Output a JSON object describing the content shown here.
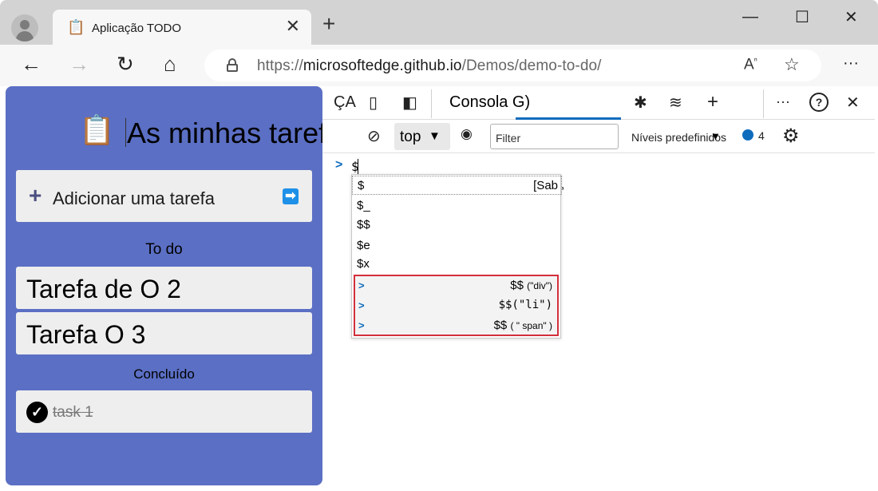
{
  "browser": {
    "tab_title": "Aplicação TODO",
    "tab_icon": "📋",
    "url_prefix": "https://",
    "url_host": "microsoftedge.github.io",
    "url_path": "/Demos/demo-to-do/",
    "read_aloud_label": "A",
    "read_aloud_mark": "ⁿ",
    "new_tab_icon": "+",
    "close_tab_icon": "✕",
    "more_icon": "···",
    "minimize_icon": "—",
    "maximize_icon": "☐",
    "close_window_icon": "✕",
    "back_icon": "←",
    "forward_icon": "→",
    "refresh_icon": "↻",
    "home_icon": "⌂",
    "favorite_icon": "☆"
  },
  "app": {
    "title": "As minhas tarefas",
    "title_icon": "📋",
    "add_task_label": "Adicionar uma tarefa",
    "add_plus": "+",
    "add_submit": "➡",
    "todo_heading": "To do",
    "todo_items": [
      "Tarefa de O 2",
      "Tarefa O 3"
    ],
    "done_heading": "Concluído",
    "done_items": [
      "task 1"
    ],
    "done_check": "✓"
  },
  "devtools": {
    "inspect_label": "ÇA",
    "console_tab_label": "Consola G)",
    "context_select": "top",
    "context_arrow": "▼",
    "filter_placeholder": "Filter",
    "levels_label": "Níveis predefinidos",
    "levels_arrow": "▼",
    "message_count": "4",
    "prompt_chevron": ">",
    "prompt_input": "$",
    "icons": {
      "device": "▯",
      "dock": "◧",
      "clear": "⊘",
      "eye": "◉",
      "bug": "✱",
      "wifi": "≋",
      "add": "+",
      "more": "···",
      "help": "?",
      "close": "✕",
      "gear": "⚙"
    },
    "autocomplete": [
      {
        "text": "$",
        "hint": "[Sab"
      },
      {
        "text": "$_"
      },
      {
        "text": "$$"
      },
      {
        "text": "$e"
      },
      {
        "text": "$x"
      }
    ],
    "autocomplete_trailing": ",",
    "history_chevron": ">",
    "history_items": [
      {
        "fn": "$$",
        "arg": "(\"div\")"
      },
      {
        "fn": "$$",
        "arg": "(\"li\")"
      },
      {
        "fn": "$$",
        "arg": "( \" span\" )"
      }
    ]
  },
  "colors": {
    "app_background": "#5b6fc4",
    "accent": "#0f6cbd",
    "highlight_border": "#d32f3c"
  }
}
